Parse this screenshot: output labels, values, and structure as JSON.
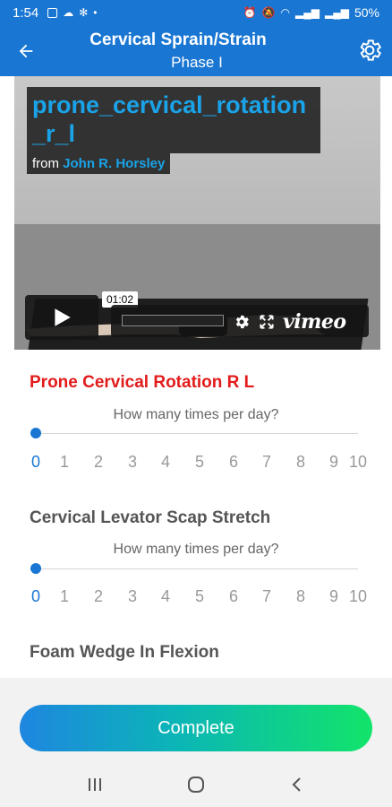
{
  "status_bar": {
    "time": "1:54",
    "battery": "50%"
  },
  "header": {
    "title": "Cervical Sprain/Strain",
    "subtitle": "Phase I"
  },
  "video": {
    "title": "prone_cervical_rotation_r_l",
    "from_label": "from",
    "author": "John R. Horsley",
    "timestamp": "01:02",
    "brand": "vimeo"
  },
  "exercises": [
    {
      "name": "Prone Cervical Rotation R L",
      "question": "How many times per day?",
      "options": [
        "0",
        "1",
        "2",
        "3",
        "4",
        "5",
        "6",
        "7",
        "8",
        "9",
        "10"
      ],
      "selected": "0"
    },
    {
      "name": "Cervical Levator Scap Stretch",
      "question": "How many times per day?",
      "options": [
        "0",
        "1",
        "2",
        "3",
        "4",
        "5",
        "6",
        "7",
        "8",
        "9",
        "10"
      ],
      "selected": "0"
    },
    {
      "name": "Foam Wedge In Flexion"
    }
  ],
  "complete_button": "Complete",
  "colors": {
    "primary": "#1976d2",
    "active_title": "#e21b1b",
    "complete_start": "#1e86e0",
    "complete_end": "#12e46a"
  },
  "icons": [
    "back-arrow-icon",
    "settings-gear-icon",
    "play-icon",
    "gear-icon",
    "fullscreen-icon",
    "recent-apps-icon",
    "home-icon",
    "back-icon"
  ]
}
